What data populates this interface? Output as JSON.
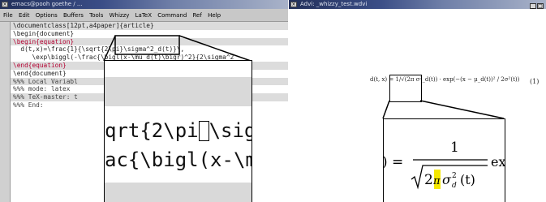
{
  "emacs": {
    "title": "emacs@pooh goethe / ...",
    "menu": [
      "File",
      "Edit",
      "Options",
      "Buffers",
      "Tools",
      "Whizzy",
      "LaTeX",
      "Command",
      "Ref",
      "Help"
    ],
    "lines": [
      {
        "pre": "\\documentclass[12pt,a4paper]{article}",
        "hl": true
      },
      {
        "pre": "\\begin{document}",
        "hl": false
      },
      {
        "kw": "\\begin{equation}",
        "hl": true
      },
      {
        "pre": "  d(t,x)=\\frac{1}{\\sqrt{2\\pi}\\sigma^2_d(t)}\\,",
        "hl": false
      },
      {
        "pre": "     \\exp\\biggl(-\\frac{\\bigl(x-\\mu_d(t)\\bigr)^2}{2\\sigma^2",
        "hl": false
      },
      {
        "kw": "\\end{equation}",
        "hl": true
      },
      {
        "pre": "\\end{document}",
        "hl": false
      },
      {
        "pre": "%%% Local Variabl",
        "hl": true
      },
      {
        "pre": "%%% mode: latex",
        "hl": false
      },
      {
        "pre": "%%% TeX-master: t",
        "hl": true
      },
      {
        "pre": "%%% End:",
        "hl": false
      }
    ],
    "zoom_line1_a": "qrt{2\\pi",
    "zoom_line1_b": "\\sig",
    "zoom_line2": "ac{\\bigl(x-\\mu"
  },
  "xdvi": {
    "title": "Advi: _whizzy_test.wdvi",
    "eq_small": "d(t, x) = 1/√(2π σ²_d(t)) · exp(−(x − μ_d(t))² / 2σ²(t))",
    "eq_number": "(1)",
    "zoom_lhs": ") =",
    "zoom_frac_num": "1",
    "zoom_den_2": "2",
    "zoom_den_pi": "π",
    "zoom_den_sigma": "σ",
    "zoom_den_sup": "2",
    "zoom_den_sub": "d",
    "zoom_den_t": "(t)",
    "zoom_exp": "ex"
  },
  "colors": {
    "keyword": "#b40030",
    "lens_highlight": "#f5e800",
    "titlebar": "#22305a"
  }
}
